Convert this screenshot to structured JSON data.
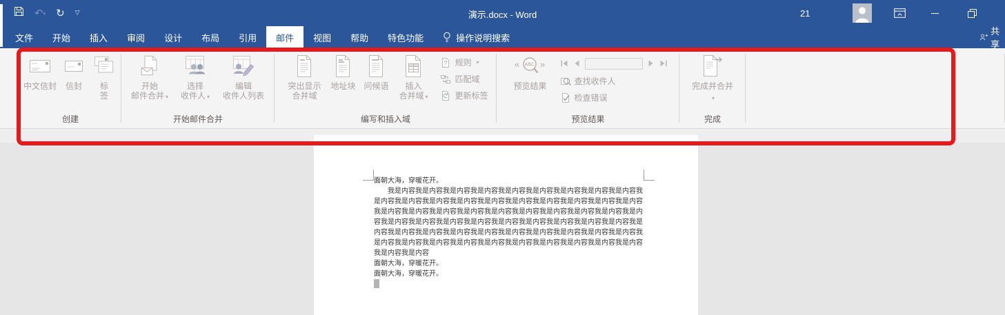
{
  "colors": {
    "titlebar_blue": "#2b579a",
    "annotation_red": "#e8191d",
    "ribbon_bg": "#f5f4f4",
    "disabled_text": "#a7a3a1",
    "doc_area_bg": "#e7e6e6"
  },
  "glyphs": {
    "dropdown": "▾",
    "undo": "↶",
    "undo_small": "▾",
    "redo": "↻",
    "qat_menu": "▽"
  },
  "titlebar": {
    "title": "演示.docx - Word",
    "user": "21"
  },
  "tabs": {
    "items": [
      "文件",
      "开始",
      "插入",
      "审阅",
      "设计",
      "布局",
      "引用",
      "邮件",
      "视图",
      "帮助",
      "特色功能"
    ],
    "selected": "邮件",
    "search": "操作说明搜索",
    "share": "共享"
  },
  "ribbon": {
    "groups": [
      {
        "label": "创建",
        "buttons": [
          {
            "l1": "中文信封"
          },
          {
            "l1": "信封"
          },
          {
            "l1": "标",
            "l2": "签"
          }
        ]
      },
      {
        "label": "开始邮件合并",
        "buttons": [
          {
            "l1": "开始",
            "l2": "邮件合并"
          },
          {
            "l1": "选择",
            "l2": "收件人"
          },
          {
            "l1": "编辑",
            "l2": "收件人列表"
          }
        ]
      },
      {
        "label": "编写和插入域",
        "buttons": [
          {
            "l1": "突出显示",
            "l2": "合并域"
          },
          {
            "l1": "地址块"
          },
          {
            "l1": "问候语"
          },
          {
            "l1": "插入",
            "l2": "合并域"
          }
        ],
        "small_buttons": [
          {
            "label": "规则"
          },
          {
            "label": "匹配域"
          },
          {
            "label": "更新标签"
          }
        ]
      },
      {
        "label": "预览结果",
        "preview_icon_text": "ABC",
        "buttons": [
          {
            "l1": "预览结果"
          }
        ],
        "small_buttons": [
          {
            "label": "查找收件人"
          },
          {
            "label": "检查错误"
          }
        ]
      },
      {
        "label": "完成",
        "buttons": [
          {
            "l1": "完成并合并"
          }
        ]
      }
    ]
  },
  "document": {
    "heading": "面朝大海，穿暖花开。",
    "paragraph": "我是内容我是内容我是内容我是内容我是内容我是内容我是内容我是内容我是内容我是内容我是内容我是内容我是内容我是内容我是内容我是内容我是内容我是内容我是内容我是内容我是内容我是内容我是内容我是内容我是内容我是内容我是内容我是内容我是内容我是内容我是内容我是内容我是内容我是内容我是内容我是内容我是内容我是内容我是内容我是内容我是内容我是内容我是内容我是内容我是内容我是内容我是内容我是内容我是内容我是内容我是内容我是内容我是内容我是内容我是内容我是内容我是内容我是内容我是内容我是内容",
    "closing_line_1": "面朝大海，穿暖花开。",
    "closing_line_2": "面朝大海，穿暖花开。"
  }
}
